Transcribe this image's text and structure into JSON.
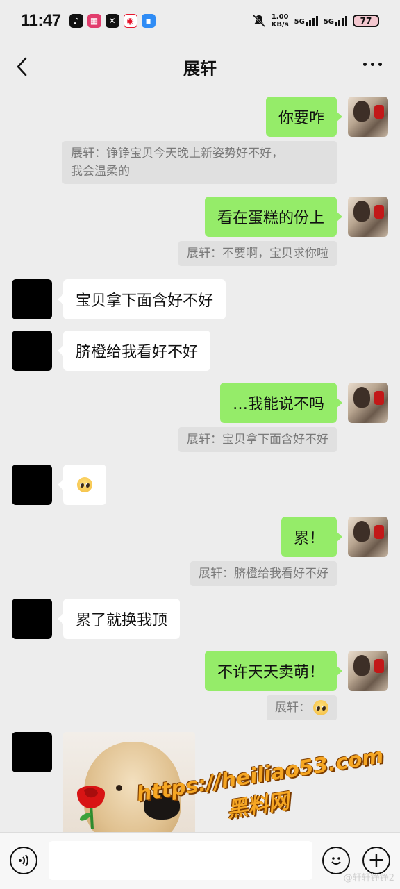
{
  "status_bar": {
    "time": "11:47",
    "net_speed_value": "1.00",
    "net_speed_unit": "KB/s",
    "signal_1": "5G",
    "signal_2": "5G",
    "battery": "77"
  },
  "header": {
    "title": "展轩"
  },
  "messages": [
    {
      "from": "self",
      "text": "你要咋",
      "quote_line1": "展轩：铮铮宝贝今天晚上新姿势好不好，",
      "quote_line2": "我会温柔的"
    },
    {
      "from": "self",
      "text": "看在蛋糕的份上",
      "quote": "展轩：不要啊，宝贝求你啦"
    },
    {
      "from": "other",
      "text": "宝贝拿下面含好不好"
    },
    {
      "from": "other",
      "text": "脐橙给我看好不好"
    },
    {
      "from": "self",
      "text": "…我能说不吗",
      "quote": "展轩：宝贝拿下面含好不好"
    },
    {
      "from": "other",
      "emoji": "pleading-face"
    },
    {
      "from": "self",
      "text": "累！",
      "quote": "展轩：脐橙给我看好不好"
    },
    {
      "from": "other",
      "text": "累了就换我顶"
    },
    {
      "from": "self",
      "text": "不许天天卖萌！",
      "quote": "展轩："
    },
    {
      "from": "other",
      "sticker": "puppy-with-rose"
    }
  ],
  "watermark": {
    "url": "https://heiliao53.com",
    "name": "黑料网"
  },
  "input_bar": {
    "placeholder": ""
  },
  "corner_mark": "@轩轩铮铮2"
}
